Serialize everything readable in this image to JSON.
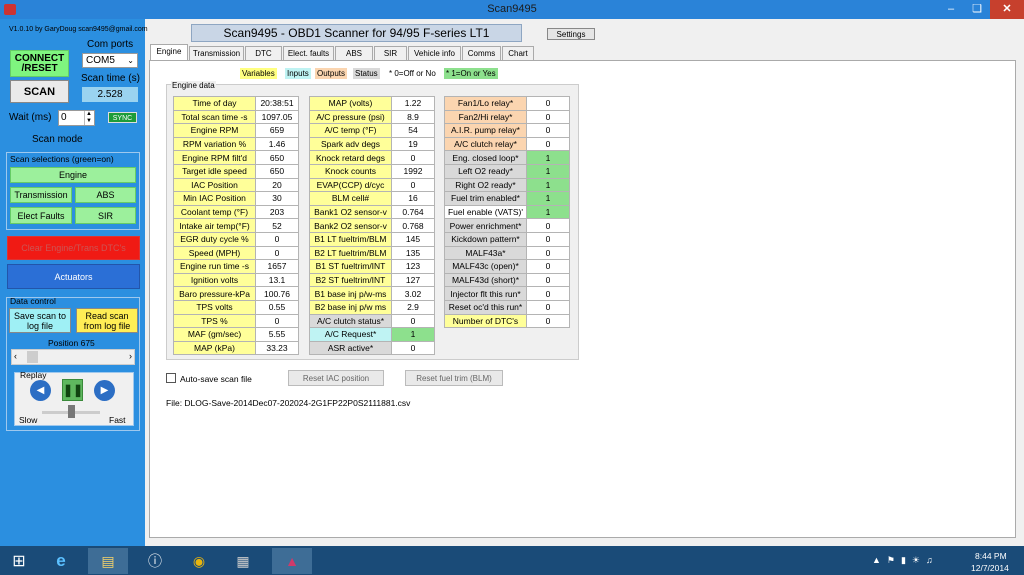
{
  "window": {
    "title": "Scan9495"
  },
  "left": {
    "version": "V1.0.10  by GaryDoug scan9495@gmail.com",
    "connect_label": "CONNECT /RESET",
    "com_ports_label": "Com ports",
    "com_value": "COM5",
    "scan_label": "SCAN",
    "scan_time_label": "Scan time (s)",
    "scan_time_value": "2.528",
    "wait_label": "Wait (ms)",
    "wait_value": "0",
    "sync_label": "SYNC",
    "scan_mode_label": "Scan mode",
    "scan_selections_label": "Scan selections (green=on)",
    "engine_btn": "Engine",
    "transmission_btn": "Transmission",
    "abs_btn": "ABS",
    "elect_faults_btn": "Elect Faults",
    "sir_btn": "SIR",
    "clear_dtc_btn": "Clear Engine/Trans DTC's",
    "actuators_btn": "Actuators",
    "data_control_label": "Data control",
    "save_scan_btn": "Save scan to log file",
    "read_scan_btn": "Read scan from log file",
    "position_label": "Position  675",
    "replay_label": "Replay",
    "slow_label": "Slow",
    "fast_label": "Fast"
  },
  "header": {
    "title": "Scan9495 - OBD1 Scanner for 94/95 F-series LT1",
    "settings_label": "Settings"
  },
  "tabs": [
    "Engine",
    "Transmission",
    "DTC",
    "Elect. faults",
    "ABS",
    "SIR",
    "Vehicle info",
    "Comms",
    "Chart"
  ],
  "legend": {
    "variables": "Variables",
    "inputs": "Inputs",
    "outputs": "Outputs",
    "status": "Status",
    "off_note": "* 0=Off or No",
    "on_note": "* 1=On or Yes"
  },
  "engine_data_label": "Engine data",
  "col1": [
    {
      "label": "Time of day",
      "value": "20:38:51"
    },
    {
      "label": "Total scan time -s",
      "value": "1097.05"
    },
    {
      "label": "Engine RPM",
      "value": "659"
    },
    {
      "label": "RPM variation %",
      "value": "1.46"
    },
    {
      "label": "Engine RPM filt'd",
      "value": "650"
    },
    {
      "label": "Target idle speed",
      "value": "650"
    },
    {
      "label": "IAC Position",
      "value": "20"
    },
    {
      "label": "Min IAC Position",
      "value": "30"
    },
    {
      "label": "Coolant temp (°F)",
      "value": "203"
    },
    {
      "label": "Intake air temp(°F)",
      "value": "52"
    },
    {
      "label": "EGR duty cycle %",
      "value": "0"
    },
    {
      "label": "Speed (MPH)",
      "value": "0"
    },
    {
      "label": "Engine run time -s",
      "value": "1657"
    },
    {
      "label": "Ignition volts",
      "value": "13.1"
    },
    {
      "label": "Baro pressure-kPa",
      "value": "100.76"
    },
    {
      "label": "TPS volts",
      "value": "0.55"
    },
    {
      "label": "TPS %",
      "value": "0"
    },
    {
      "label": "MAF (gm/sec)",
      "value": "5.55"
    },
    {
      "label": "MAP (kPa)",
      "value": "33.23"
    }
  ],
  "col2": [
    {
      "label": "MAP (volts)",
      "value": "1.22"
    },
    {
      "label": "A/C pressure (psi)",
      "value": "8.9"
    },
    {
      "label": "A/C temp (°F)",
      "value": "54"
    },
    {
      "label": "Spark adv degs",
      "value": "19"
    },
    {
      "label": "Knock retard degs",
      "value": "0"
    },
    {
      "label": "Knock counts",
      "value": "1992"
    },
    {
      "label": "EVAP(CCP) d/cyc",
      "value": "0"
    },
    {
      "label": "BLM cell#",
      "value": "16"
    },
    {
      "label": "Bank1 O2 sensor-v",
      "value": "0.764"
    },
    {
      "label": "Bank2 O2 sensor-v",
      "value": "0.768"
    },
    {
      "label": "B1 LT fueltrim/BLM",
      "value": "145"
    },
    {
      "label": "B2 LT fueltrim/BLM",
      "value": "135"
    },
    {
      "label": "B1 ST fueltrim/INT",
      "value": "123"
    },
    {
      "label": "B2 ST fueltrim/INT",
      "value": "127"
    },
    {
      "label": "B1 base inj p/w-ms",
      "value": "3.02"
    },
    {
      "label": "B2 base inj p/w ms",
      "value": "2.9"
    },
    {
      "label": "A/C clutch status*",
      "value": "0"
    },
    {
      "label": "A/C Request*",
      "value": "1"
    },
    {
      "label": "ASR active*",
      "value": "0"
    }
  ],
  "col3": [
    {
      "label": "Fan1/Lo relay*",
      "value": "0"
    },
    {
      "label": "Fan2/Hi relay*",
      "value": "0"
    },
    {
      "label": "A.I.R. pump relay*",
      "value": "0"
    },
    {
      "label": "A/C clutch relay*",
      "value": "0"
    },
    {
      "label": "Eng. closed loop*",
      "value": "1"
    },
    {
      "label": "Left O2 ready*",
      "value": "1"
    },
    {
      "label": "Right O2 ready*",
      "value": "1"
    },
    {
      "label": "Fuel trim enabled*",
      "value": "1"
    },
    {
      "label": "Fuel enable (VATS)'",
      "value": "1"
    },
    {
      "label": "Power enrichment*",
      "value": "0"
    },
    {
      "label": "Kickdown pattern*",
      "value": "0"
    },
    {
      "label": "MALF43a*",
      "value": "0"
    },
    {
      "label": "MALF43c (open)*",
      "value": "0"
    },
    {
      "label": "MALF43d (short)*",
      "value": "0"
    },
    {
      "label": "Injector flt this run*",
      "value": "0"
    },
    {
      "label": "Reset oc'd this run*",
      "value": "0"
    },
    {
      "label": "Number of DTC's",
      "value": "0"
    }
  ],
  "bottom": {
    "auto_save_label": "Auto-save scan file",
    "reset_iac_label": "Reset IAC position",
    "reset_fuel_label": "Reset fuel trim (BLM)",
    "file_label": "File: DLOG-Save-2014Dec07-202024-2G1FP22P0S2111881.csv"
  },
  "taskbar": {
    "time": "8:44 PM",
    "date": "12/7/2014"
  }
}
